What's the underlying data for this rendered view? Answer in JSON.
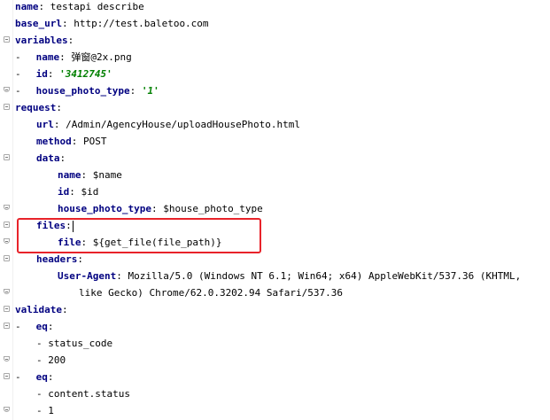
{
  "lines": [
    {
      "fold": "",
      "dash": "",
      "key": "name",
      "rest": " testapi describe",
      "indent": 0
    },
    {
      "fold": "",
      "dash": "",
      "key": "base_url",
      "rest": " http://test.baletoo.com",
      "indent": 0
    },
    {
      "fold": "open",
      "dash": "",
      "key": "variables",
      "rest": "",
      "indent": 0
    },
    {
      "fold": "",
      "dash": "-",
      "key": "name",
      "rest": " 弹窗@2x.png",
      "indent": 1
    },
    {
      "fold": "",
      "dash": "-",
      "key": "id",
      "rest": "",
      "str": "'3412745'",
      "indent": 1
    },
    {
      "fold": "end",
      "dash": "-",
      "key": "house_photo_type",
      "rest": "",
      "str": "'1'",
      "indent": 1
    },
    {
      "fold": "open",
      "dash": "",
      "key": "request",
      "rest": "",
      "indent": 0
    },
    {
      "fold": "",
      "dash": "",
      "key": "url",
      "rest": " /Admin/AgencyHouse/uploadHousePhoto.html",
      "indent": 1
    },
    {
      "fold": "",
      "dash": "",
      "key": "method",
      "rest": " POST",
      "indent": 1
    },
    {
      "fold": "open",
      "dash": "",
      "key": "data",
      "rest": "",
      "indent": 1
    },
    {
      "fold": "",
      "dash": "",
      "key": "name",
      "rest": " $name",
      "indent": 2
    },
    {
      "fold": "",
      "dash": "",
      "key": "id",
      "rest": " $id",
      "indent": 2
    },
    {
      "fold": "end",
      "dash": "",
      "key": "house_photo_type",
      "rest": " $house_photo_type",
      "indent": 2
    },
    {
      "fold": "open",
      "dash": "",
      "key": "files",
      "rest": "",
      "indent": 1,
      "caret": true
    },
    {
      "fold": "end",
      "dash": "",
      "key": "file",
      "rest": " ${get_file(file_path)}",
      "indent": 2
    },
    {
      "fold": "open",
      "dash": "",
      "key": "headers",
      "rest": "",
      "indent": 1
    },
    {
      "fold": "",
      "dash": "",
      "key": "User-Agent",
      "rest": " Mozilla/5.0 (Windows NT 6.1; Win64; x64) AppleWebKit/537.36 (KHTML,",
      "indent": 2
    },
    {
      "fold": "end",
      "dash": "",
      "key": "",
      "rest": "like Gecko) Chrome/62.0.3202.94 Safari/537.36",
      "indent": 3
    },
    {
      "fold": "open",
      "dash": "",
      "key": "validate",
      "rest": "",
      "indent": 0
    },
    {
      "fold": "open",
      "dash": "-",
      "key": "eq",
      "rest": "",
      "indent": 1
    },
    {
      "fold": "",
      "dash": "",
      "key": "",
      "rest": "- status_code",
      "indent": 1
    },
    {
      "fold": "end",
      "dash": "",
      "key": "",
      "rest": "- 200",
      "indent": 1
    },
    {
      "fold": "open",
      "dash": "-",
      "key": "eq",
      "rest": "",
      "indent": 1
    },
    {
      "fold": "",
      "dash": "",
      "key": "",
      "rest": "- content.status",
      "indent": 1
    },
    {
      "fold": "end",
      "dash": "",
      "key": "",
      "rest": "- 1",
      "indent": 1
    }
  ],
  "colors": {
    "key": "#000080",
    "string": "#008000",
    "highlight_border": "#e8232a"
  }
}
